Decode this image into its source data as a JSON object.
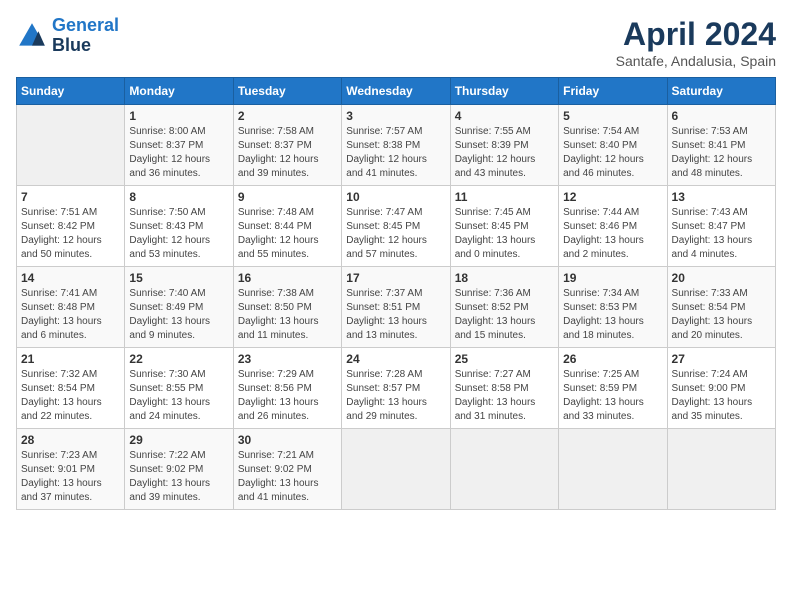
{
  "logo": {
    "line1": "General",
    "line2": "Blue"
  },
  "title": "April 2024",
  "location": "Santafe, Andalusia, Spain",
  "days_header": [
    "Sunday",
    "Monday",
    "Tuesday",
    "Wednesday",
    "Thursday",
    "Friday",
    "Saturday"
  ],
  "weeks": [
    [
      {
        "day": "",
        "info": ""
      },
      {
        "day": "1",
        "info": "Sunrise: 8:00 AM\nSunset: 8:37 PM\nDaylight: 12 hours\nand 36 minutes."
      },
      {
        "day": "2",
        "info": "Sunrise: 7:58 AM\nSunset: 8:37 PM\nDaylight: 12 hours\nand 39 minutes."
      },
      {
        "day": "3",
        "info": "Sunrise: 7:57 AM\nSunset: 8:38 PM\nDaylight: 12 hours\nand 41 minutes."
      },
      {
        "day": "4",
        "info": "Sunrise: 7:55 AM\nSunset: 8:39 PM\nDaylight: 12 hours\nand 43 minutes."
      },
      {
        "day": "5",
        "info": "Sunrise: 7:54 AM\nSunset: 8:40 PM\nDaylight: 12 hours\nand 46 minutes."
      },
      {
        "day": "6",
        "info": "Sunrise: 7:53 AM\nSunset: 8:41 PM\nDaylight: 12 hours\nand 48 minutes."
      }
    ],
    [
      {
        "day": "7",
        "info": "Sunrise: 7:51 AM\nSunset: 8:42 PM\nDaylight: 12 hours\nand 50 minutes."
      },
      {
        "day": "8",
        "info": "Sunrise: 7:50 AM\nSunset: 8:43 PM\nDaylight: 12 hours\nand 53 minutes."
      },
      {
        "day": "9",
        "info": "Sunrise: 7:48 AM\nSunset: 8:44 PM\nDaylight: 12 hours\nand 55 minutes."
      },
      {
        "day": "10",
        "info": "Sunrise: 7:47 AM\nSunset: 8:45 PM\nDaylight: 12 hours\nand 57 minutes."
      },
      {
        "day": "11",
        "info": "Sunrise: 7:45 AM\nSunset: 8:45 PM\nDaylight: 13 hours\nand 0 minutes."
      },
      {
        "day": "12",
        "info": "Sunrise: 7:44 AM\nSunset: 8:46 PM\nDaylight: 13 hours\nand 2 minutes."
      },
      {
        "day": "13",
        "info": "Sunrise: 7:43 AM\nSunset: 8:47 PM\nDaylight: 13 hours\nand 4 minutes."
      }
    ],
    [
      {
        "day": "14",
        "info": "Sunrise: 7:41 AM\nSunset: 8:48 PM\nDaylight: 13 hours\nand 6 minutes."
      },
      {
        "day": "15",
        "info": "Sunrise: 7:40 AM\nSunset: 8:49 PM\nDaylight: 13 hours\nand 9 minutes."
      },
      {
        "day": "16",
        "info": "Sunrise: 7:38 AM\nSunset: 8:50 PM\nDaylight: 13 hours\nand 11 minutes."
      },
      {
        "day": "17",
        "info": "Sunrise: 7:37 AM\nSunset: 8:51 PM\nDaylight: 13 hours\nand 13 minutes."
      },
      {
        "day": "18",
        "info": "Sunrise: 7:36 AM\nSunset: 8:52 PM\nDaylight: 13 hours\nand 15 minutes."
      },
      {
        "day": "19",
        "info": "Sunrise: 7:34 AM\nSunset: 8:53 PM\nDaylight: 13 hours\nand 18 minutes."
      },
      {
        "day": "20",
        "info": "Sunrise: 7:33 AM\nSunset: 8:54 PM\nDaylight: 13 hours\nand 20 minutes."
      }
    ],
    [
      {
        "day": "21",
        "info": "Sunrise: 7:32 AM\nSunset: 8:54 PM\nDaylight: 13 hours\nand 22 minutes."
      },
      {
        "day": "22",
        "info": "Sunrise: 7:30 AM\nSunset: 8:55 PM\nDaylight: 13 hours\nand 24 minutes."
      },
      {
        "day": "23",
        "info": "Sunrise: 7:29 AM\nSunset: 8:56 PM\nDaylight: 13 hours\nand 26 minutes."
      },
      {
        "day": "24",
        "info": "Sunrise: 7:28 AM\nSunset: 8:57 PM\nDaylight: 13 hours\nand 29 minutes."
      },
      {
        "day": "25",
        "info": "Sunrise: 7:27 AM\nSunset: 8:58 PM\nDaylight: 13 hours\nand 31 minutes."
      },
      {
        "day": "26",
        "info": "Sunrise: 7:25 AM\nSunset: 8:59 PM\nDaylight: 13 hours\nand 33 minutes."
      },
      {
        "day": "27",
        "info": "Sunrise: 7:24 AM\nSunset: 9:00 PM\nDaylight: 13 hours\nand 35 minutes."
      }
    ],
    [
      {
        "day": "28",
        "info": "Sunrise: 7:23 AM\nSunset: 9:01 PM\nDaylight: 13 hours\nand 37 minutes."
      },
      {
        "day": "29",
        "info": "Sunrise: 7:22 AM\nSunset: 9:02 PM\nDaylight: 13 hours\nand 39 minutes."
      },
      {
        "day": "30",
        "info": "Sunrise: 7:21 AM\nSunset: 9:02 PM\nDaylight: 13 hours\nand 41 minutes."
      },
      {
        "day": "",
        "info": ""
      },
      {
        "day": "",
        "info": ""
      },
      {
        "day": "",
        "info": ""
      },
      {
        "day": "",
        "info": ""
      }
    ]
  ]
}
